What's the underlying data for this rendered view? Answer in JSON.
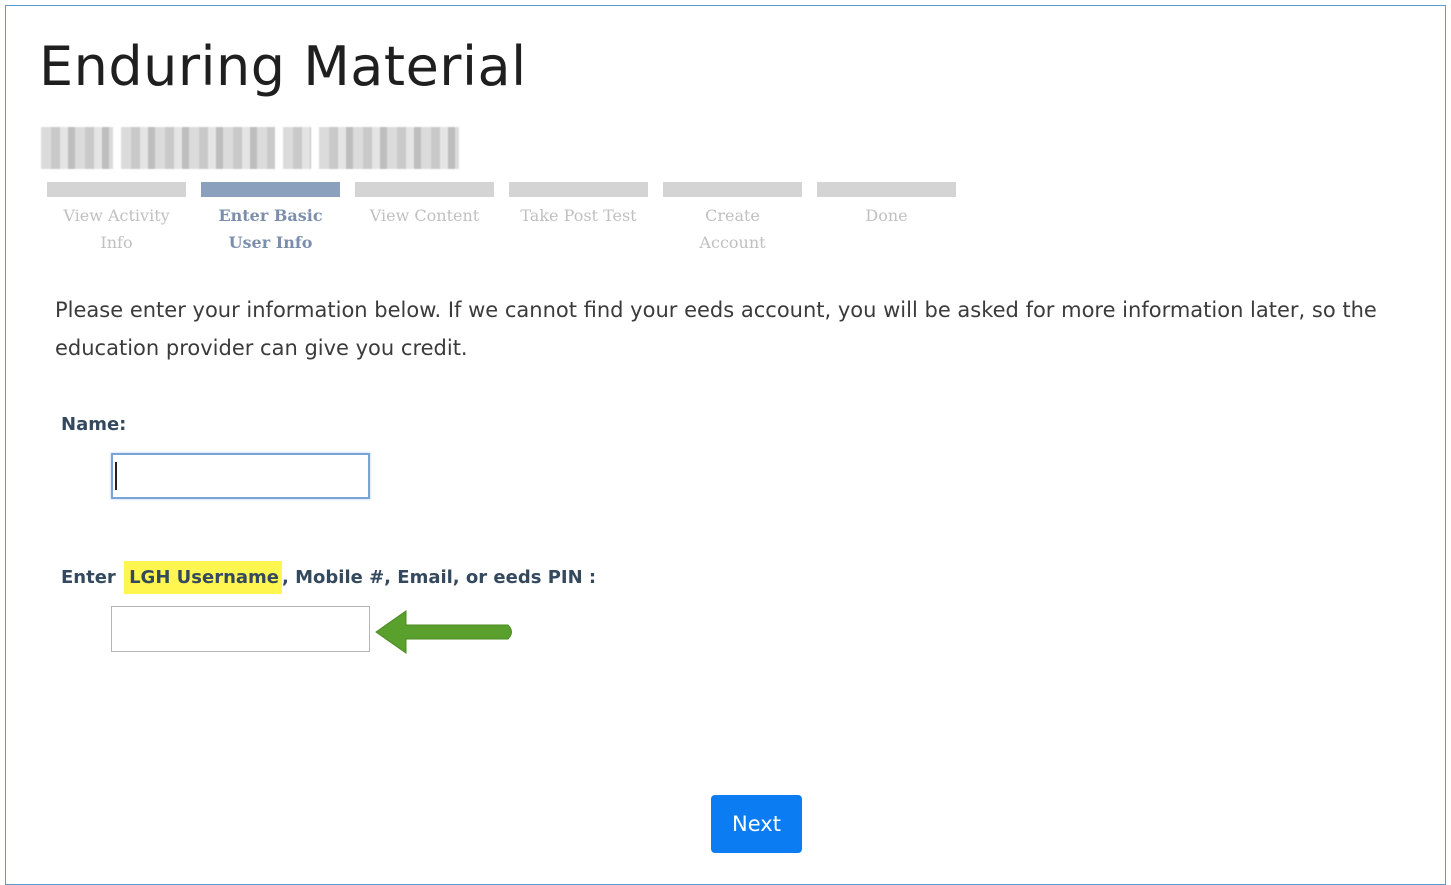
{
  "page": {
    "title": "Enduring Material"
  },
  "steps": [
    {
      "label": "View Activity Info",
      "active": false
    },
    {
      "label": "Enter Basic User Info",
      "active": true
    },
    {
      "label": "View Content",
      "active": false
    },
    {
      "label": "Take Post Test",
      "active": false
    },
    {
      "label": "Create Account",
      "active": false
    },
    {
      "label": "Done",
      "active": false
    }
  ],
  "intro": {
    "text": "Please enter your information below. If we cannot find your eeds account, you will be asked for more information later, so the education provider can give you credit."
  },
  "form": {
    "name_label": "Name:",
    "name_value": "",
    "id_label_prefix": "Enter ",
    "id_label_highlight": "LGH Username",
    "id_label_suffix": ", Mobile #, Email, or eeds PIN :",
    "id_value": ""
  },
  "actions": {
    "next_label": "Next"
  },
  "colors": {
    "frame_border": "#5b9bd5",
    "active_step": "#8aa0bd",
    "highlight": "#fff64f",
    "arrow": "#5aa02c",
    "next_button": "#0c7cf2"
  },
  "icons": {
    "arrow": "left-arrow-icon"
  }
}
